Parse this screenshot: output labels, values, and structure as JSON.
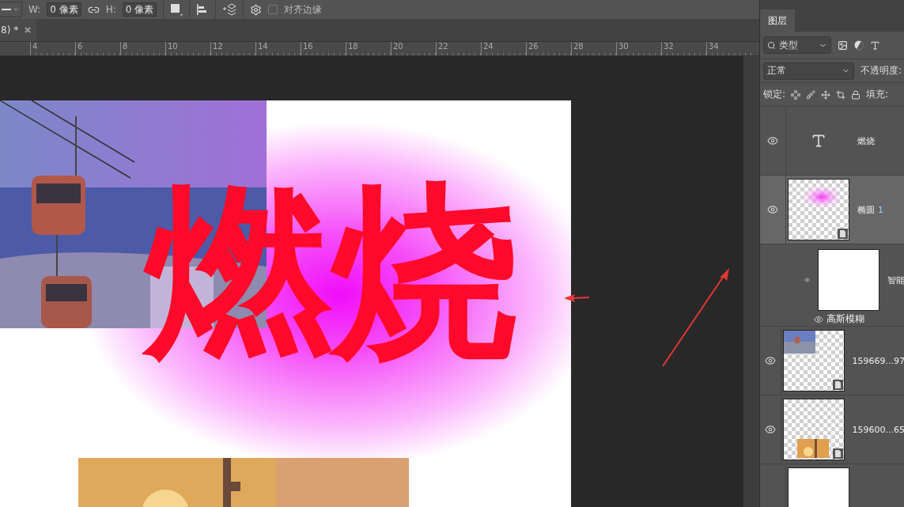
{
  "toolbar": {
    "width_label": "W:",
    "width_value": "0 像素",
    "height_label": "H:",
    "height_value": "0 像素",
    "align_edges": {
      "label": "对齐边缘",
      "checked": false
    }
  },
  "document_tab": {
    "title": "8) *"
  },
  "ruler": {
    "labels": [
      "4",
      "6",
      "8",
      "10",
      "12",
      "14",
      "16",
      "18",
      "20",
      "22",
      "24",
      "26",
      "28",
      "30",
      "32",
      "34"
    ]
  },
  "canvas": {
    "headline": "燃烧"
  },
  "layers_panel": {
    "tab": {
      "label": "图层",
      "selected": true
    },
    "filter": "类型",
    "blend_mode": "正常",
    "opacity_label": "不透明度:",
    "lock_label": "锁定:",
    "fill_label": "填充:",
    "layers": [
      {
        "kind": "text",
        "name": "燃烧",
        "visible": true,
        "selected": false
      },
      {
        "kind": "glow",
        "name": "椭圆",
        "badge": "1",
        "visible": true,
        "selected": true,
        "filters": {
          "label": "智能",
          "items": [
            {
              "name": "高斯模糊",
              "visible": true
            }
          ]
        }
      },
      {
        "kind": "photo_top",
        "name": "159669...97",
        "visible": true,
        "selected": false
      },
      {
        "kind": "photo_bottom",
        "name": "159600...65",
        "visible": true,
        "selected": false
      },
      {
        "kind": "plain",
        "visible": false,
        "selected": false
      }
    ]
  }
}
